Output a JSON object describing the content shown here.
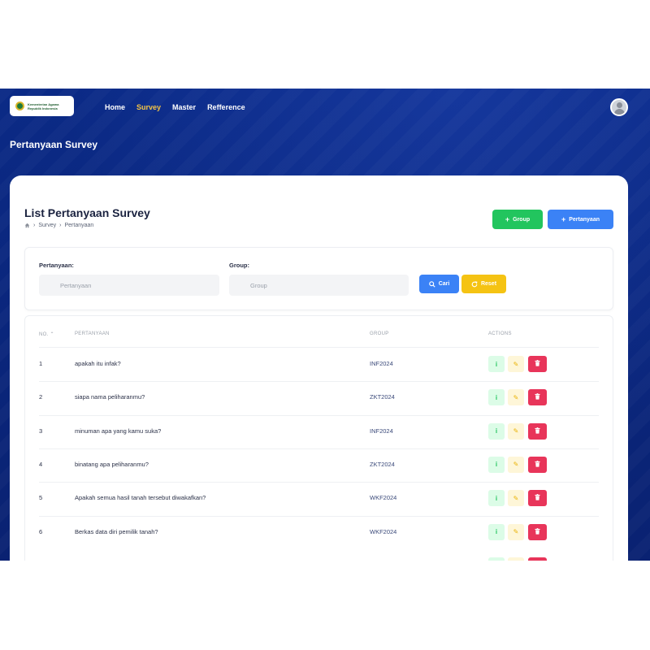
{
  "brand": {
    "logo_line1": "Kementerian Agama",
    "logo_line2": "Republik Indonesia"
  },
  "nav": {
    "items": [
      {
        "label": "Home",
        "active": false
      },
      {
        "label": "Survey",
        "active": true
      },
      {
        "label": "Master",
        "active": false
      },
      {
        "label": "Refference",
        "active": false
      }
    ]
  },
  "page": {
    "heading": "Pertanyaan Survey"
  },
  "card": {
    "title": "List Pertanyaan Survey",
    "breadcrumb": [
      "Survey",
      "Pertanyaan"
    ],
    "btn_group": "Group",
    "btn_pertanyaan": "Pertanyaan"
  },
  "filter": {
    "pertanyaan_label": "Pertanyaan:",
    "pertanyaan_placeholder": "Pertanyaan",
    "group_label": "Group:",
    "group_placeholder": "Group",
    "btn_cari": "Cari",
    "btn_reset": "Reset"
  },
  "table": {
    "headers": {
      "no": "NO.",
      "pertanyaan": "PERTANYAAN",
      "group": "GROUP",
      "actions": "ACTIONS"
    },
    "rows": [
      {
        "no": "1",
        "pertanyaan": "apakah itu infak?",
        "group": "INF2024"
      },
      {
        "no": "2",
        "pertanyaan": "siapa nama peliharanmu?",
        "group": "ZKT2024"
      },
      {
        "no": "3",
        "pertanyaan": "minuman apa yang kamu suka?",
        "group": "INF2024"
      },
      {
        "no": "4",
        "pertanyaan": "binatang apa peliharanmu?",
        "group": "ZKT2024"
      },
      {
        "no": "5",
        "pertanyaan": "Apakah semua hasil tanah tersebut diwakafkan?",
        "group": "WKF2024"
      },
      {
        "no": "6",
        "pertanyaan": "Berkas data diri pemilik tanah?",
        "group": "WKF2024"
      }
    ]
  },
  "colors": {
    "header_bg": "#0b2a86",
    "nav_active": "#f6c445",
    "btn_green": "#22c55e",
    "btn_blue": "#3b82f6",
    "btn_yellow": "#f5c313",
    "btn_delete": "#e8355a"
  }
}
